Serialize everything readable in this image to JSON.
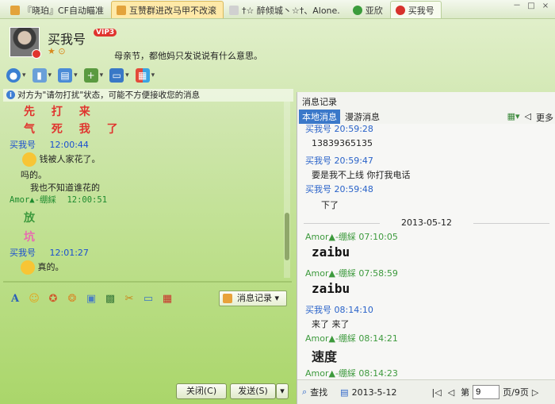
{
  "tabs": [
    {
      "label": "『晓珀』CF自动瞄准",
      "color": "#e3a33c"
    },
    {
      "label": "互赞群进改马甲不改滚",
      "color": "#e3a33c"
    },
    {
      "label": "†☆ 醉倾城丶☆†、Alone.",
      "color": "#7a7a7a"
    },
    {
      "label": "亚欣",
      "color": "#3b9c3b"
    },
    {
      "label": "买我号",
      "color": "#d7322c"
    }
  ],
  "window": {
    "minimize": "－",
    "maximize": "□",
    "close": "×"
  },
  "contact": {
    "name": "买我号",
    "vip": "VIP3",
    "signature": "母亲节，都他妈只发说说有什么意思。"
  },
  "info_bar": "对方为\"请勿打扰\"状态，可能不方便接收您的消息",
  "chat": {
    "line1": "先 打 来",
    "line2": "气 死 我 了",
    "msg1_sender": "买我号",
    "msg1_time": "12:00:44",
    "msg1_text": "钱被人家花了。",
    "msg1_text2": "吗的。",
    "msg1_text3": "我也不知道谁花的",
    "msg2_sender": "Amor▲-绷綵",
    "msg2_time": "12:00:51",
    "line3": "放",
    "line4": "坑",
    "msg3_sender": "买我号",
    "msg3_time": "12:01:27",
    "msg3_text": "真的。"
  },
  "format_bar": {
    "msg_record": "消息记录"
  },
  "buttons": {
    "close": "关闭(C)",
    "send": "发送(S)"
  },
  "history": {
    "title": "消息记录",
    "tab_local": "本地消息",
    "tab_roaming": "漫游消息",
    "more": "更多",
    "rows": [
      {
        "type": "blue",
        "text": "买我号 20:59:28"
      },
      {
        "type": "msg",
        "text": "13839365135"
      },
      {
        "type": "blue",
        "text": "买我号 20:59:47"
      },
      {
        "type": "msg",
        "text": "要是我不上线   你打我电话"
      },
      {
        "type": "blue",
        "text": "买我号 20:59:48"
      },
      {
        "type": "msg",
        "text": "下了"
      }
    ],
    "date": "2013-05-12",
    "rows2": [
      {
        "type": "green",
        "text": "Amor▲-绷綵 07:10:05"
      },
      {
        "type": "big",
        "text": "zaibu"
      },
      {
        "type": "green",
        "text": "Amor▲-绷綵 07:58:59"
      },
      {
        "type": "big",
        "text": "zaibu"
      },
      {
        "type": "blue",
        "text": "买我号 08:14:10"
      },
      {
        "type": "msg",
        "text": "来了  来了"
      },
      {
        "type": "green",
        "text": "Amor▲-绷綵 08:14:21"
      },
      {
        "type": "bigcn",
        "text": "速度"
      },
      {
        "type": "green",
        "text": "Amor▲-绷綵 08:14:23"
      }
    ],
    "footer": {
      "search": "查找",
      "date": "2013-5-12",
      "page_prefix": "第",
      "page_value": "9",
      "page_suffix": "页/9页"
    }
  }
}
